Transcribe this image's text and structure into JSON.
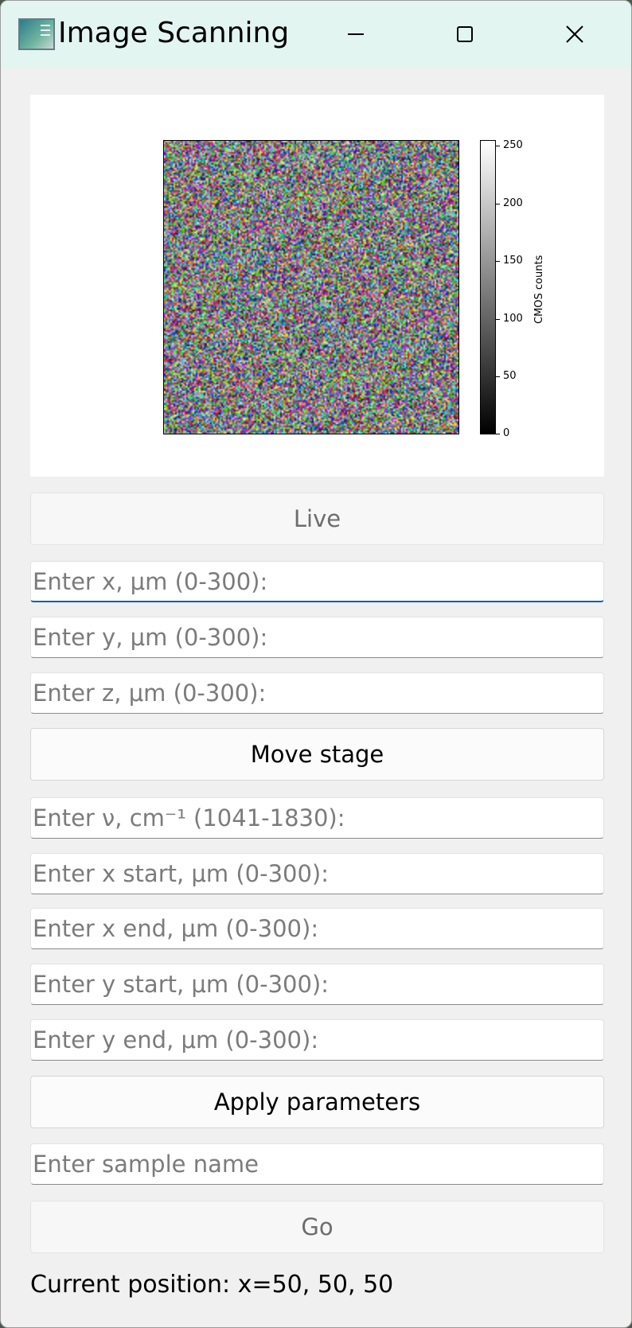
{
  "window": {
    "title": "Image Scanning",
    "icon": "app-chart-icon"
  },
  "plot": {
    "colorbar": {
      "label": "CMOS counts",
      "ticks": [
        "250",
        "200",
        "150",
        "100",
        "50",
        "0"
      ],
      "range": [
        0,
        255
      ]
    }
  },
  "buttons": {
    "live": "Live",
    "move_stage": "Move stage",
    "apply_parameters": "Apply parameters",
    "go": "Go"
  },
  "inputs": {
    "x": {
      "value": "",
      "placeholder": "Enter x, μm (0-300):"
    },
    "y": {
      "value": "",
      "placeholder": "Enter y, μm (0-300):"
    },
    "z": {
      "value": "",
      "placeholder": "Enter z, μm (0-300):"
    },
    "nu": {
      "value": "",
      "placeholder": "Enter ν, cm⁻¹ (1041-1830):"
    },
    "x_start": {
      "value": "",
      "placeholder": "Enter x start, μm (0-300):"
    },
    "x_end": {
      "value": "",
      "placeholder": "Enter x end, μm (0-300):"
    },
    "y_start": {
      "value": "",
      "placeholder": "Enter y start, μm (0-300):"
    },
    "y_end": {
      "value": "",
      "placeholder": "Enter y end, μm (0-300):"
    },
    "sample_name": {
      "value": "",
      "placeholder": "Enter sample name"
    }
  },
  "status": {
    "text": "Current position: x=50, 50, 50"
  }
}
